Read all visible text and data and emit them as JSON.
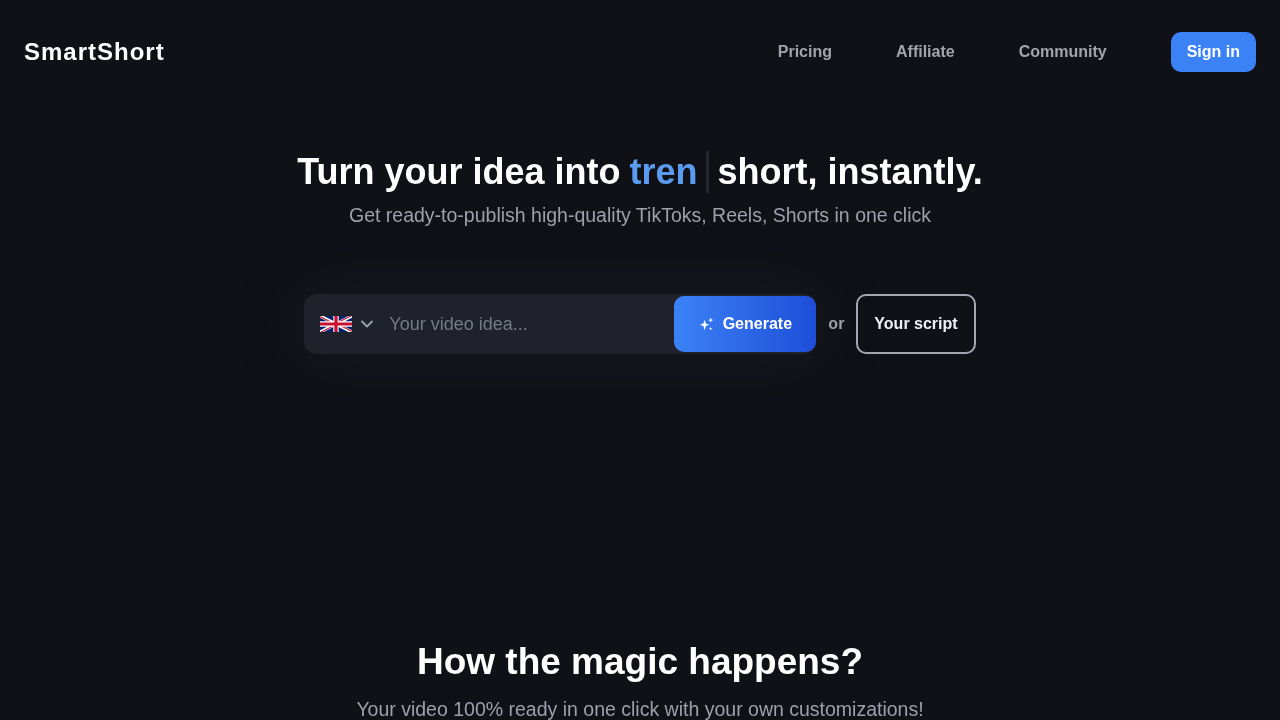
{
  "header": {
    "logo": "SmartShort",
    "nav": [
      {
        "label": "Pricing"
      },
      {
        "label": "Affiliate"
      },
      {
        "label": "Community"
      }
    ],
    "sign_in": "Sign in"
  },
  "hero": {
    "headline": {
      "lead": "Turn your idea into",
      "typed": "tren",
      "tail": "short, instantly."
    },
    "subtitle": "Get ready-to-publish high-quality TikToks, Reels, Shorts in one click",
    "prompt": {
      "placeholder": "Your video idea...",
      "generate": "Generate"
    },
    "or": "or",
    "script_button": "Your script"
  },
  "how_it_works": {
    "title": "How the magic happens?",
    "subtitle": "Your video 100% ready in one click with your own customizations!"
  }
}
